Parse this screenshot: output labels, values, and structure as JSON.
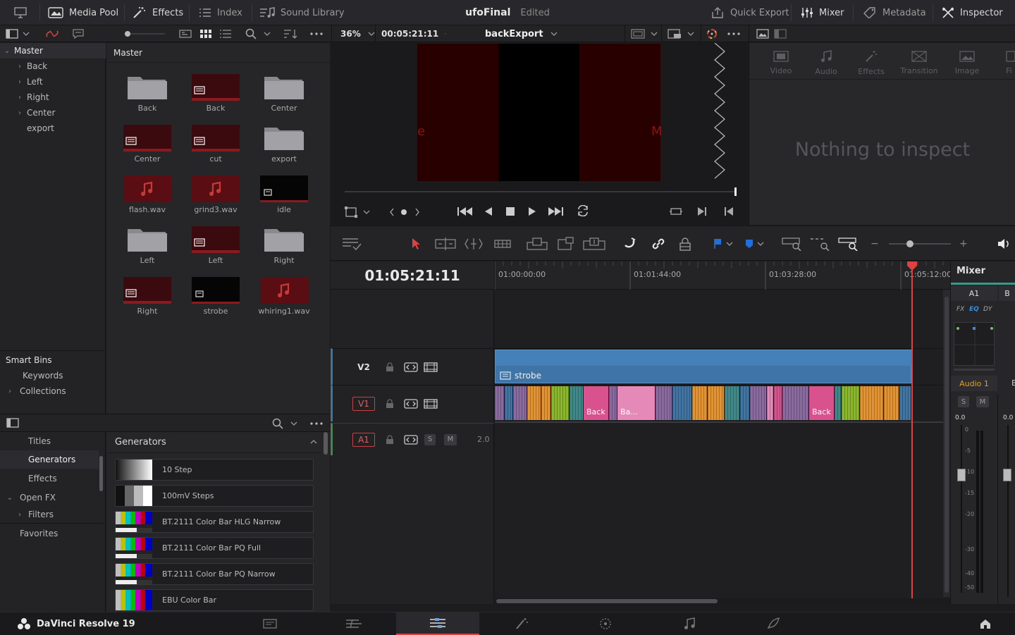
{
  "topbar": {
    "media_pool": "Media Pool",
    "effects": "Effects",
    "index": "Index",
    "sound_library": "Sound Library",
    "project_name": "ufoFinal",
    "project_status": "Edited",
    "quick_export": "Quick Export",
    "mixer": "Mixer",
    "metadata": "Metadata",
    "inspector": "Inspector"
  },
  "viewer_bar": {
    "zoom": "36%",
    "timecode": "00:05:21:11",
    "sequence": "backExport"
  },
  "bins": {
    "root": "Master",
    "items": [
      "Back",
      "Left",
      "Right",
      "Center",
      "export"
    ],
    "smart_bins": "Smart Bins",
    "smart_items": [
      "Keywords",
      "Collections"
    ]
  },
  "pool": {
    "header": "Master",
    "clips": [
      {
        "name": "Back",
        "kind": "folder"
      },
      {
        "name": "Back",
        "kind": "timeline"
      },
      {
        "name": "Center",
        "kind": "folder"
      },
      {
        "name": "Center",
        "kind": "timeline"
      },
      {
        "name": "cut",
        "kind": "timeline"
      },
      {
        "name": "export",
        "kind": "folder"
      },
      {
        "name": "flash.wav",
        "kind": "audio"
      },
      {
        "name": "grind3.wav",
        "kind": "audio"
      },
      {
        "name": "idle",
        "kind": "black"
      },
      {
        "name": "Left",
        "kind": "folder"
      },
      {
        "name": "Left",
        "kind": "timeline"
      },
      {
        "name": "Right",
        "kind": "folder"
      },
      {
        "name": "Right",
        "kind": "timeline"
      },
      {
        "name": "strobe",
        "kind": "black"
      },
      {
        "name": "whiring1.wav",
        "kind": "audio"
      }
    ]
  },
  "effects_tree": {
    "items": [
      "Titles",
      "Generators",
      "Effects",
      "Open FX",
      "Filters",
      "Favorites"
    ],
    "selected": "Generators"
  },
  "generators": {
    "header": "Generators",
    "items": [
      "10 Step",
      "100mV Steps",
      "BT.2111 Color Bar HLG Narrow",
      "BT.2111 Color Bar PQ Full",
      "BT.2111 Color Bar PQ Narrow",
      "EBU Color Bar"
    ]
  },
  "viewer": {
    "left_letter": "e",
    "right_letter": "M"
  },
  "inspector": {
    "tabs": [
      "Video",
      "Audio",
      "Effects",
      "Transition",
      "Image",
      "Fi"
    ],
    "empty_message": "Nothing to inspect"
  },
  "timeline": {
    "timecode": "01:05:21:11",
    "ruler_labels": [
      "01:00:00:00",
      "01:01:44:00",
      "01:03:28:00",
      "01:05:12:00"
    ],
    "tracks": {
      "v2": "V2",
      "v1": "V1",
      "a1": "A1",
      "a1_channels": "2.0",
      "solo": "S",
      "mute": "M"
    },
    "v2_clip": "strobe",
    "v1_labels": [
      "Back",
      "Ba...",
      "Back"
    ]
  },
  "mixer": {
    "title": "Mixer",
    "channel": "A1",
    "channel2": "B",
    "fx": "FX",
    "eq": "EQ",
    "dy": "DY",
    "track_name": "Audio 1",
    "solo": "S",
    "mute": "M",
    "level": "0.0",
    "level2": "0.0",
    "scale": [
      "0",
      "-5",
      "-10",
      "-15",
      "-20",
      "-30",
      "-40",
      "-50"
    ]
  },
  "bottombar": {
    "app_name": "DaVinci Resolve 19"
  },
  "colors": {
    "accent_red": "#e04040",
    "timeline_blue": "#3f74a6",
    "clip_pink": "#d9528e",
    "clip_orange": "#e8922c",
    "clip_green": "#8bb825"
  }
}
